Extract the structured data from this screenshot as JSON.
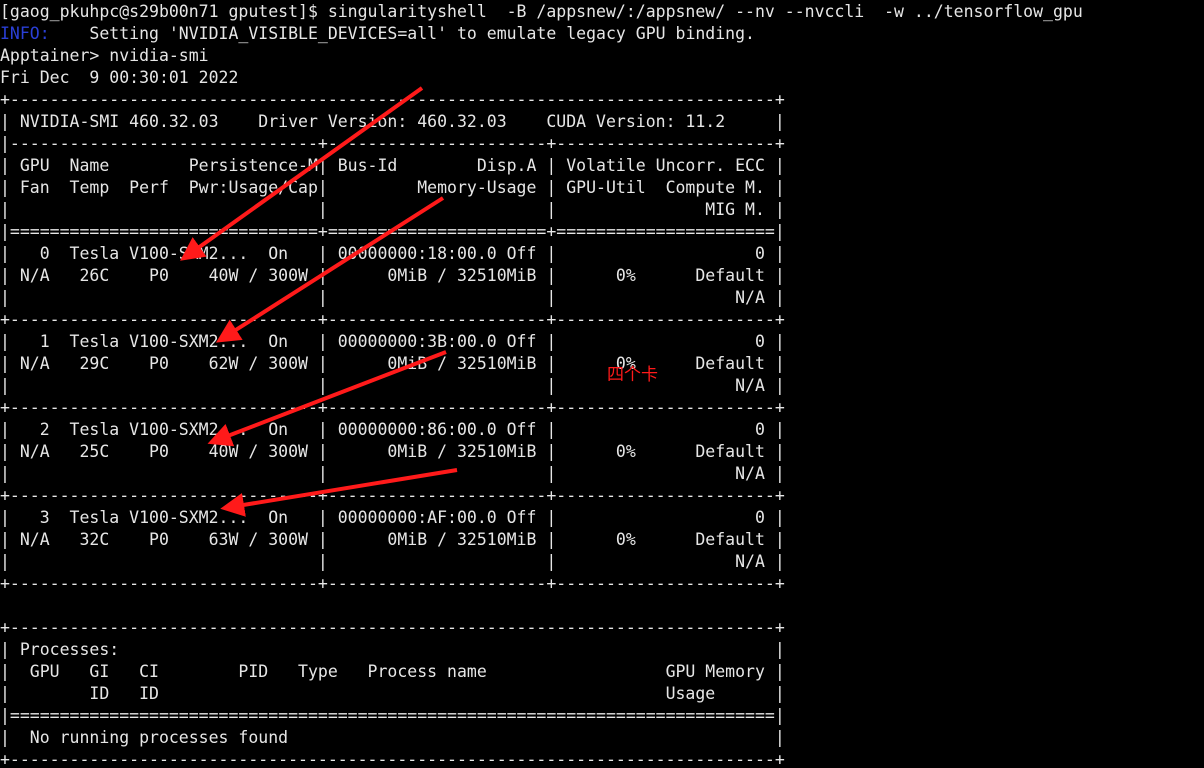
{
  "terminal": {
    "lines": [
      "[gaog_pkuhpc@s29b00n71 gputest]$ singularityshell  -B /appsnew/:/appsnew/ --nv --nvccli  -w ../tensorflow_gpu",
      "INFO:    Setting 'NVIDIA_VISIBLE_DEVICES=all' to emulate legacy GPU binding.",
      "Apptainer> nvidia-smi",
      "Fri Dec  9 00:30:01 2022",
      "+-----------------------------------------------------------------------------+",
      "| NVIDIA-SMI 460.32.03    Driver Version: 460.32.03    CUDA Version: 11.2     |",
      "|-------------------------------+----------------------+----------------------+",
      "| GPU  Name        Persistence-M| Bus-Id        Disp.A | Volatile Uncorr. ECC |",
      "| Fan  Temp  Perf  Pwr:Usage/Cap|         Memory-Usage | GPU-Util  Compute M. |",
      "|                               |                      |               MIG M. |",
      "|===============================+======================+======================|",
      "|   0  Tesla V100-SXM2...  On   | 00000000:18:00.0 Off |                    0 |",
      "| N/A   26C    P0    40W / 300W |      0MiB / 32510MiB |      0%      Default |",
      "|                               |                      |                  N/A |",
      "+-------------------------------+----------------------+----------------------+",
      "|   1  Tesla V100-SXM2...  On   | 00000000:3B:00.0 Off |                    0 |",
      "| N/A   29C    P0    62W / 300W |      0MiB / 32510MiB |      0%      Default |",
      "|                               |                      |                  N/A |",
      "+-------------------------------+----------------------+----------------------+",
      "|   2  Tesla V100-SXM2...  On   | 00000000:86:00.0 Off |                    0 |",
      "| N/A   25C    P0    40W / 300W |      0MiB / 32510MiB |      0%      Default |",
      "|                               |                      |                  N/A |",
      "+-------------------------------+----------------------+----------------------+",
      "|   3  Tesla V100-SXM2...  On   | 00000000:AF:00.0 Off |                    0 |",
      "| N/A   32C    P0    63W / 300W |      0MiB / 32510MiB |      0%      Default |",
      "|                               |                      |                  N/A |",
      "+-------------------------------+----------------------+----------------------+",
      "",
      "+-----------------------------------------------------------------------------+",
      "| Processes:                                                                  |",
      "|  GPU   GI   CI        PID   Type   Process name                  GPU Memory |",
      "|        ID   ID                                                   Usage      |",
      "|=============================================================================|",
      "|  No running processes found                                                 |",
      "+-----------------------------------------------------------------------------+"
    ],
    "info_label": "INFO:",
    "info_rest": "    Setting 'NVIDIA_VISIBLE_DEVICES=all' to emulate legacy GPU binding."
  },
  "annotation": {
    "text": "四个卡",
    "color": "#ff1a1a"
  },
  "colors": {
    "background": "#000000",
    "text": "#e6e6e6",
    "info": "#2a3fd6",
    "annotation_red": "#ff1a1a"
  }
}
